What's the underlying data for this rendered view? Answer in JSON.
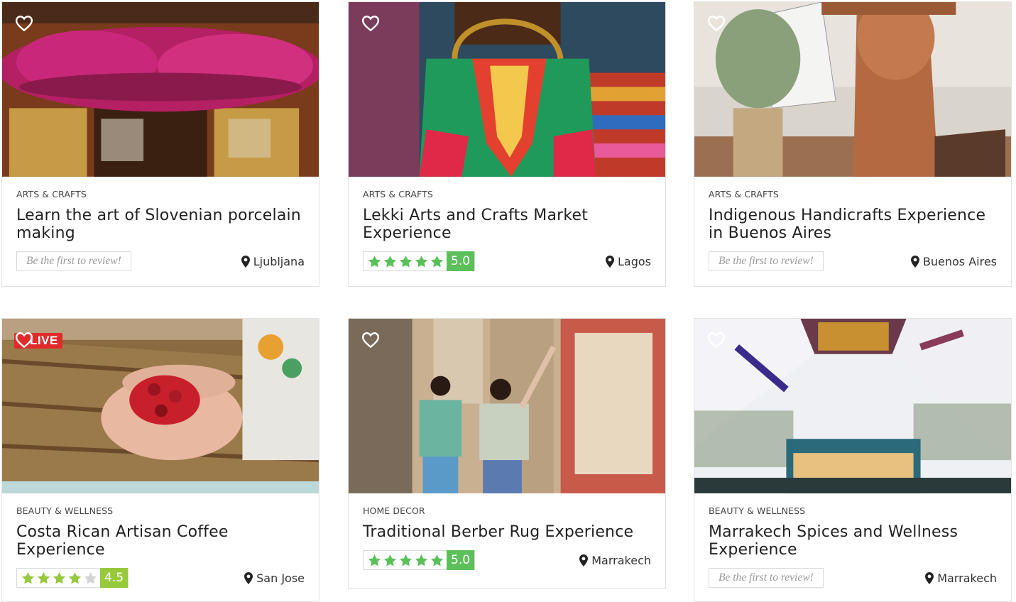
{
  "cards": [
    {
      "category": "ARTS & CRAFTS",
      "title": "Learn the art of Slovenian porcelain making",
      "review_prompt": "Be the first to review!",
      "location": "Ljubljana",
      "image": "porcelain-shop-storefront-with-pink-flowers"
    },
    {
      "category": "ARTS & CRAFTS",
      "title": "Lekki Arts and Crafts Market Experience",
      "rating": "5.0",
      "rating_value": 5,
      "location": "Lagos",
      "image": "colorful-african-print-handbag"
    },
    {
      "category": "ARTS & CRAFTS",
      "title": "Indigenous Handicrafts Experience in Buenos Aires",
      "review_prompt": "Be the first to review!",
      "location": "Buenos Aires",
      "image": "clay-sculpture-and-woven-vase"
    },
    {
      "category": "BEAUTY & WELLNESS",
      "title": "Costa Rican Artisan Coffee Experience",
      "rating": "4.5",
      "rating_value": 4.5,
      "location": "San Jose",
      "badge": "LIVE",
      "image": "hands-holding-red-coffee-cherries"
    },
    {
      "category": "HOME DECOR",
      "title": "Traditional Berber Rug Experience",
      "rating": "5.0",
      "rating_value": 5,
      "location": "Marrakech",
      "image": "women-browsing-rugs-in-souk"
    },
    {
      "category": "BEAUTY & WELLNESS",
      "title": "Marrakech Spices and Wellness Experience",
      "review_prompt": "Be the first to review!",
      "location": "Marrakech",
      "image": "spice-shop-interior"
    }
  ],
  "icons": {
    "favorite": "heart-outline-icon",
    "location": "map-pin-icon",
    "star": "star-icon"
  },
  "colors": {
    "rating_green": "#5cc05a",
    "rating_lime": "#97c93d",
    "live_red": "#e12b2b"
  }
}
